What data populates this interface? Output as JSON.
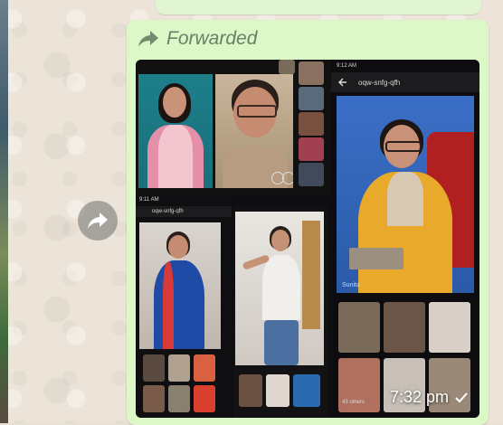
{
  "message": {
    "forwarded_label": "Forwarded",
    "timestamp": "7:32 pm",
    "status_icon": "single-check-icon"
  },
  "screenshots": {
    "right_phone": {
      "status_time": "9:12 AM",
      "meeting_code": "oqw-snfg-qfh",
      "pinned_name": "Sunita",
      "others_label": "43 others"
    },
    "lower_left_phone": {
      "status_time": "9:11 AM",
      "meeting_code": "oqw-snfg-qfh"
    }
  },
  "colors": {
    "bubble": "#dcf8c6",
    "chat_background": "#ece4d8",
    "forwarded_text": "#6a7e68"
  }
}
